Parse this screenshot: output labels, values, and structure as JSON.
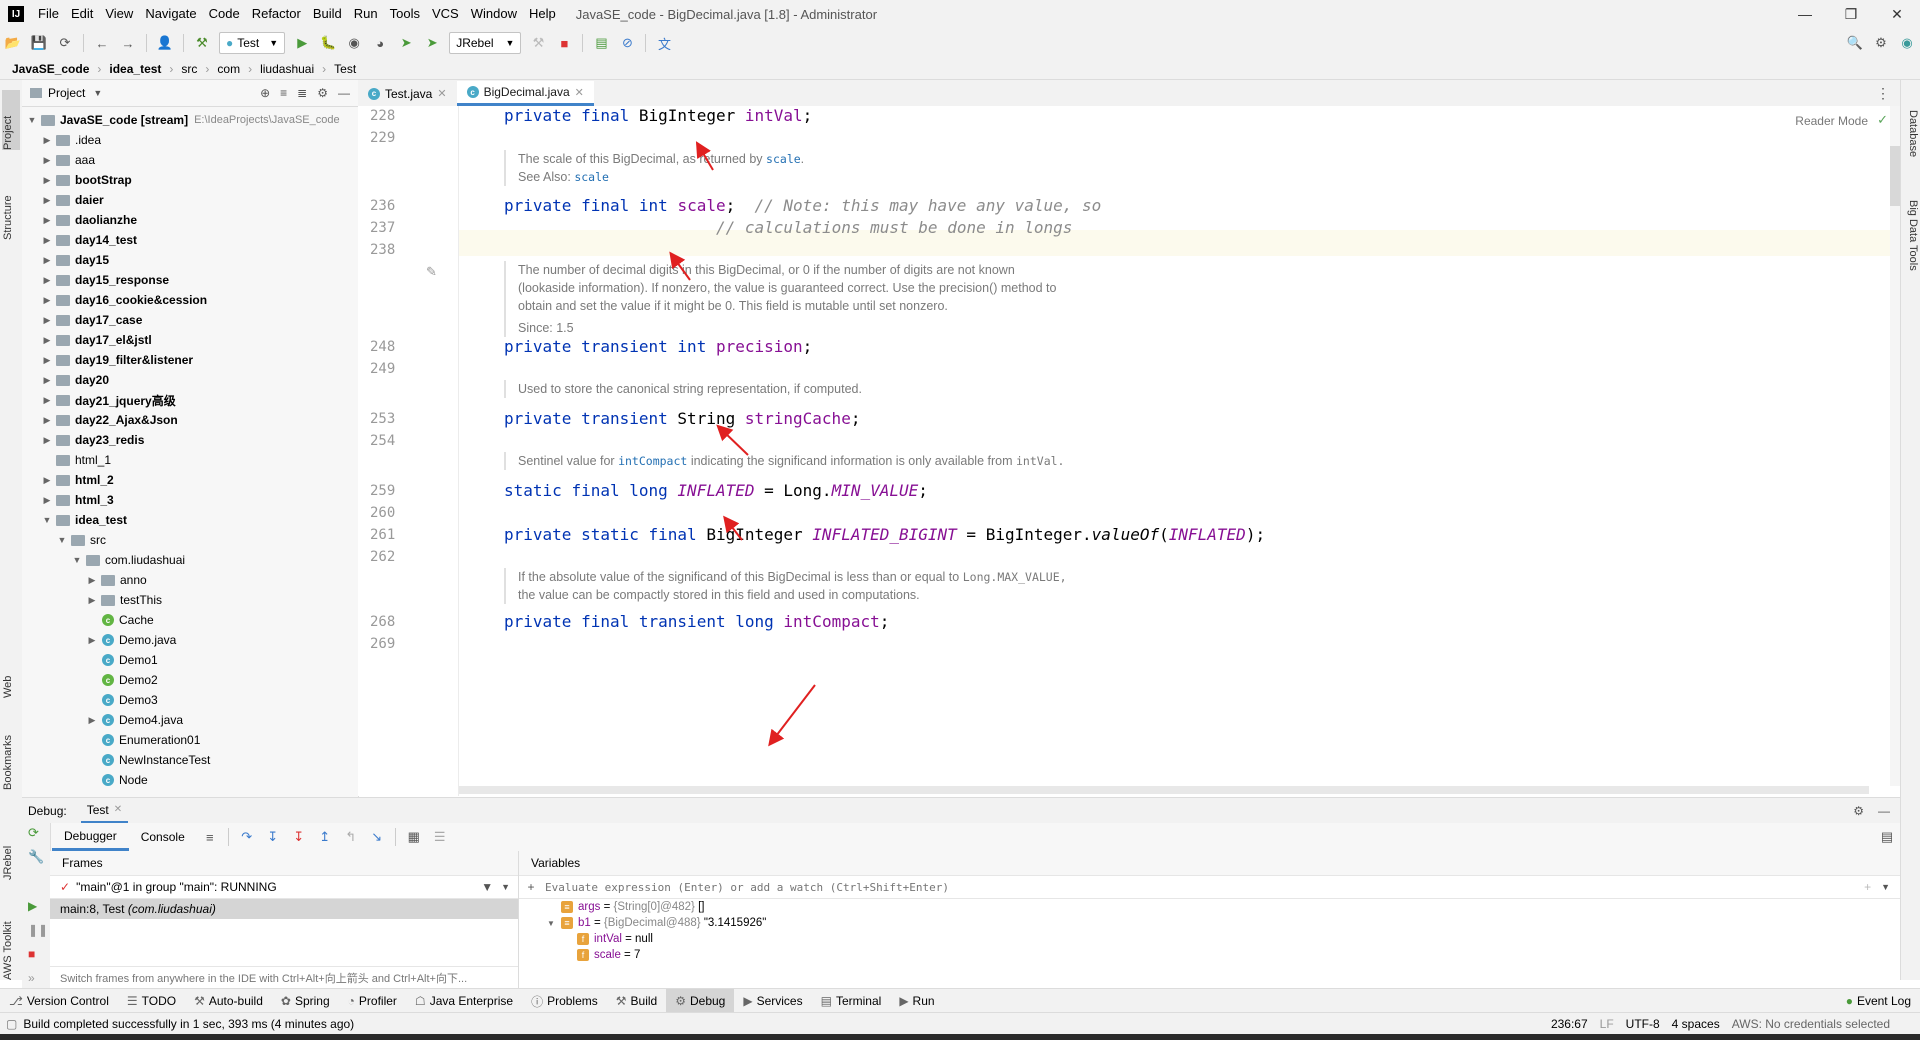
{
  "menu": [
    "File",
    "Edit",
    "View",
    "Navigate",
    "Code",
    "Refactor",
    "Build",
    "Run",
    "Tools",
    "VCS",
    "Window",
    "Help"
  ],
  "window_title": "JavaSE_code - BigDecimal.java [1.8] - Administrator",
  "toolbar": {
    "run_config": "Test",
    "jrebel": "JRebel"
  },
  "breadcrumb": [
    "JavaSE_code",
    "idea_test",
    "src",
    "com",
    "liudashuai",
    "Test"
  ],
  "project_panel": {
    "title": "Project",
    "root_label": "JavaSE_code [stream]",
    "root_path": "E:\\IdeaProjects\\JavaSE_code",
    "items": [
      {
        "label": ".idea",
        "kind": "folder",
        "bold": false
      },
      {
        "label": "aaa",
        "kind": "folder",
        "bold": false
      },
      {
        "label": "bootStrap",
        "kind": "folder",
        "bold": true
      },
      {
        "label": "daier",
        "kind": "folder",
        "bold": true
      },
      {
        "label": "daolianzhe",
        "kind": "folder",
        "bold": true
      },
      {
        "label": "day14_test",
        "kind": "folder",
        "bold": true
      },
      {
        "label": "day15",
        "kind": "folder",
        "bold": true
      },
      {
        "label": "day15_response",
        "kind": "folder",
        "bold": true
      },
      {
        "label": "day16_cookie&cession",
        "kind": "folder",
        "bold": true
      },
      {
        "label": "day17_case",
        "kind": "folder",
        "bold": true
      },
      {
        "label": "day17_el&jstl",
        "kind": "folder",
        "bold": true
      },
      {
        "label": "day19_filter&listener",
        "kind": "folder",
        "bold": true
      },
      {
        "label": "day20",
        "kind": "folder",
        "bold": true
      },
      {
        "label": "day21_jquery高级",
        "kind": "folder",
        "bold": true
      },
      {
        "label": "day22_Ajax&Json",
        "kind": "folder",
        "bold": true
      },
      {
        "label": "day23_redis",
        "kind": "folder",
        "bold": true
      },
      {
        "label": "html_1",
        "kind": "folder",
        "bold": false
      },
      {
        "label": "html_2",
        "kind": "folder",
        "bold": true
      },
      {
        "label": "html_3",
        "kind": "folder",
        "bold": true
      },
      {
        "label": "idea_test",
        "kind": "folder",
        "bold": true
      },
      {
        "label": "src",
        "kind": "folder",
        "bold": false
      },
      {
        "label": "com.liudashuai",
        "kind": "folder",
        "bold": false
      },
      {
        "label": "anno",
        "kind": "folder",
        "bold": false
      },
      {
        "label": "testThis",
        "kind": "folder",
        "bold": false
      },
      {
        "label": "Cache",
        "kind": "class-g",
        "bold": false
      },
      {
        "label": "Demo.java",
        "kind": "class",
        "bold": false
      },
      {
        "label": "Demo1",
        "kind": "class",
        "bold": false
      },
      {
        "label": "Demo2",
        "kind": "class-g",
        "bold": false
      },
      {
        "label": "Demo3",
        "kind": "class",
        "bold": false
      },
      {
        "label": "Demo4.java",
        "kind": "class",
        "bold": false
      },
      {
        "label": "Enumeration01",
        "kind": "class",
        "bold": false
      },
      {
        "label": "NewInstanceTest",
        "kind": "class",
        "bold": false
      },
      {
        "label": "Node",
        "kind": "class",
        "bold": false
      }
    ]
  },
  "editor": {
    "tabs": [
      {
        "label": "Test.java"
      },
      {
        "label": "BigDecimal.java"
      }
    ],
    "reader_mode": "Reader Mode",
    "line_numbers": [
      "228",
      "229",
      "236",
      "237",
      "238",
      "248",
      "249",
      "253",
      "254",
      "259",
      "260",
      "261",
      "262",
      "268",
      "269"
    ],
    "docs": {
      "scale_text": "The scale of this BigDecimal, as returned by",
      "scale_link": "scale",
      "see_also": "See Also:",
      "precision_1": "The number of decimal digits in this BigDecimal, or 0 if the number of digits are not known",
      "precision_2": "(lookaside information). If nonzero, the value is guaranteed correct. Use the precision() method to",
      "precision_3": "obtain and set the value if it might be 0. This field is mutable until set nonzero.",
      "since": "Since: 1.5",
      "string_cache": "Used to store the canonical string representation, if computed.",
      "sentinel_1": "Sentinel value for",
      "sentinel_link": "intCompact",
      "sentinel_2": "indicating the significand information is only available from",
      "sentinel_code": "intVal.",
      "compact_1": "If the absolute value of the significand of this BigDecimal is less than or equal to",
      "compact_code": "Long.MAX_VALUE,",
      "compact_2": "the value can be compactly stored in this field and used in computations."
    },
    "tokens": {
      "private": "private",
      "final": "final",
      "transient": "transient",
      "static": "static",
      "int": "int",
      "long": "long",
      "BigInteger": "BigInteger",
      "String": "String",
      "Long": "Long",
      "intVal": "intVal",
      "scale": "scale",
      "precision": "precision",
      "stringCache": "stringCache",
      "INFLATED": "INFLATED",
      "MIN_VALUE": "MIN_VALUE",
      "INFLATED_BIGINT": "INFLATED_BIGINT",
      "valueOf": "valueOf",
      "intCompact": "intCompact",
      "comment_1": "// Note: this may have any value, so",
      "comment_2": "// calculations must be done in longs"
    }
  },
  "left_tool_tabs": [
    "Project",
    "Structure",
    "Web",
    "Bookmarks",
    "JRebel",
    "AWS Toolkit"
  ],
  "right_tool_tabs": [
    "Database",
    "Big Data Tools"
  ],
  "debug": {
    "label": "Debug:",
    "session_tab": "Test",
    "tabs": [
      "Debugger",
      "Console"
    ],
    "frames_title": "Frames",
    "thread": "\"main\"@1 in group \"main\": RUNNING",
    "frame_method": "main:8, Test",
    "frame_pkg": "(com.liudashuai)",
    "frames_hint": "Switch frames from anywhere in the IDE with Ctrl+Alt+向上箭头 and Ctrl+Alt+向下...",
    "variables_title": "Variables",
    "eval_placeholder": "Evaluate expression (Enter) or add a watch (Ctrl+Shift+Enter)",
    "vars": [
      {
        "name": "args",
        "meta": "{String[0]@482}",
        "value": "[]",
        "level": 0
      },
      {
        "name": "b1",
        "meta": "{BigDecimal@488}",
        "value": "\"3.1415926\"",
        "level": 0
      },
      {
        "name": "intVal",
        "meta": "",
        "value": "null",
        "level": 1
      },
      {
        "name": "scale",
        "meta": "",
        "value": "7",
        "level": 1
      }
    ]
  },
  "tool_tabs": [
    "Version Control",
    "TODO",
    "Auto-build",
    "Spring",
    "Profiler",
    "Java Enterprise",
    "Problems",
    "Build",
    "Debug",
    "Services",
    "Terminal",
    "Run"
  ],
  "event_log": "Event Log",
  "status": {
    "message": "Build completed successfully in 1 sec, 393 ms (4 minutes ago)",
    "position": "236:67",
    "line_sep": "LF",
    "encoding": "UTF-8",
    "indent": "4 spaces",
    "aws": "AWS: No credentials selected"
  },
  "colors": {
    "accent": "#4083c9",
    "keyword": "#0033b3",
    "field": "#871094",
    "arrow": "#e02020"
  }
}
